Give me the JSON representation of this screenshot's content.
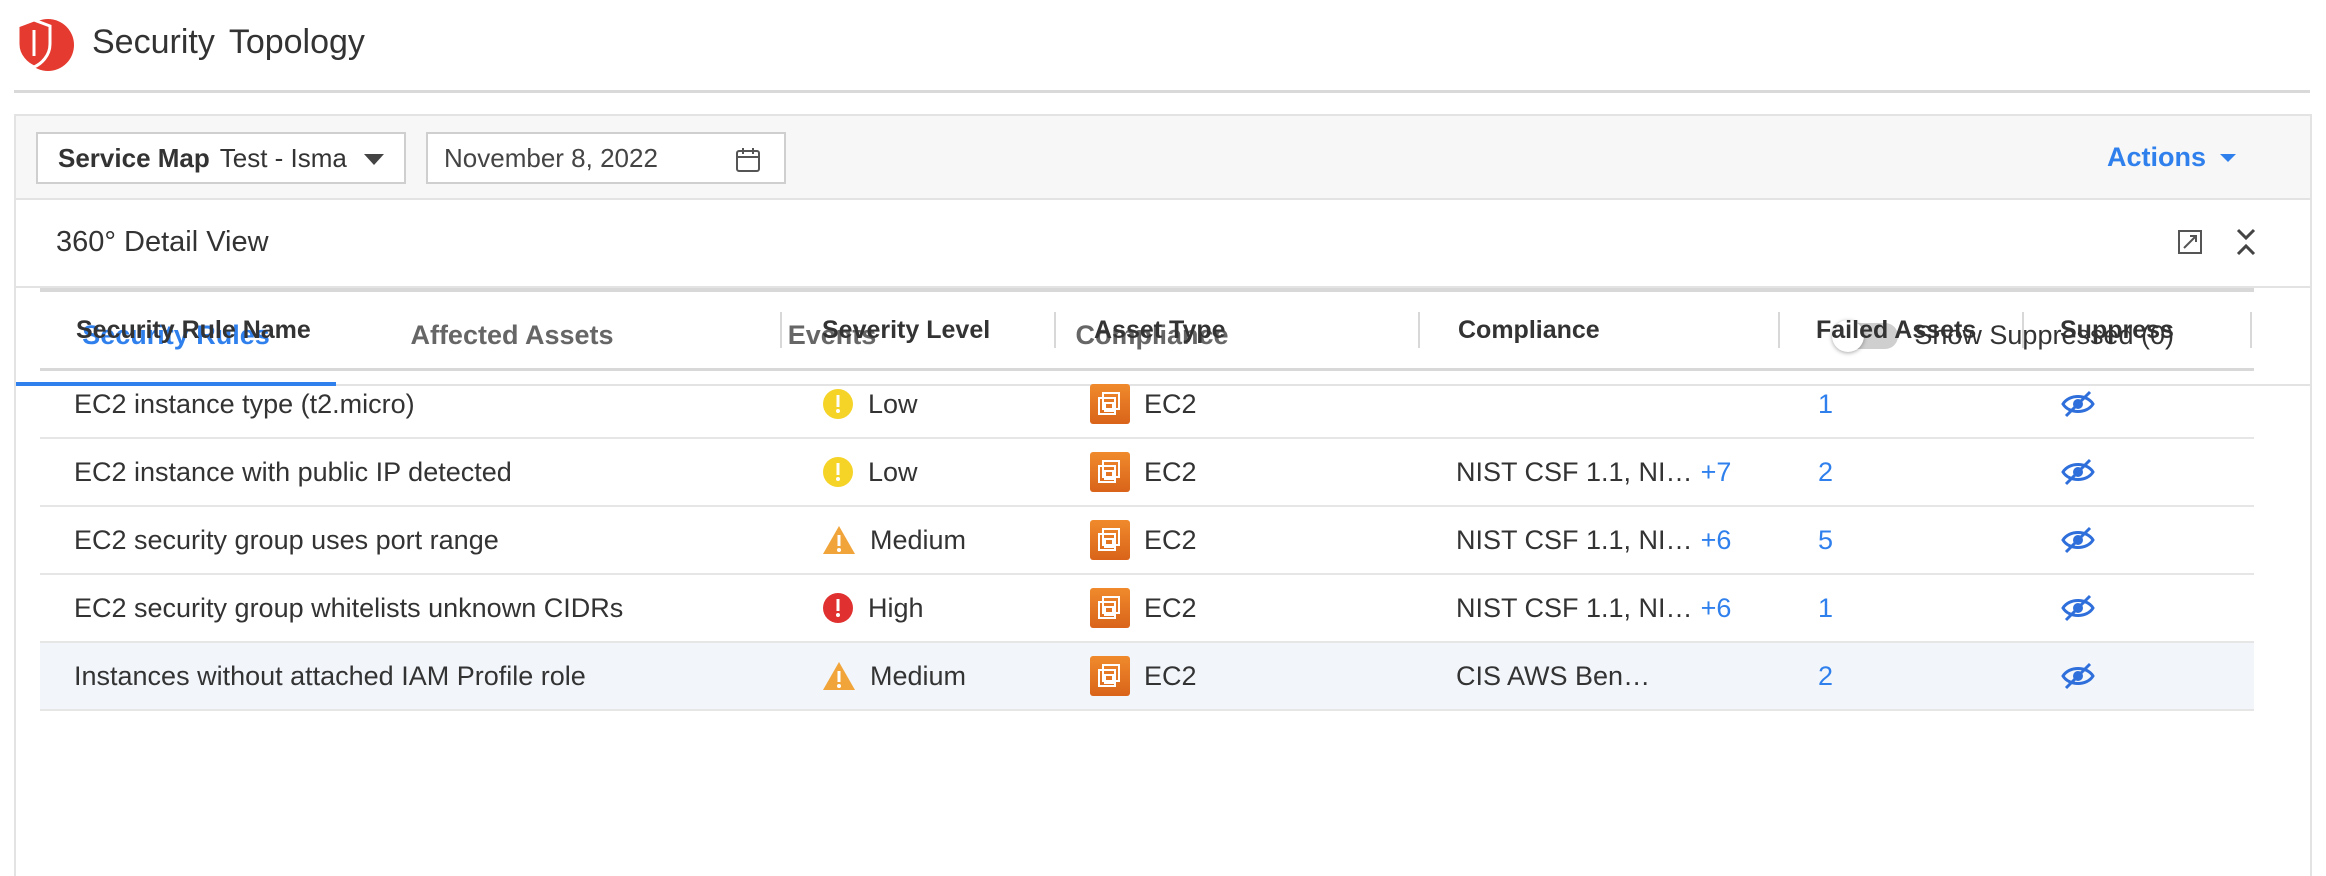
{
  "header": {
    "title": "Security",
    "subtitle": "Topology"
  },
  "toolbar": {
    "service_map_label": "Service Map",
    "service_map_value": "Test - Isma",
    "date_value": "November 8, 2022",
    "actions_label": "Actions"
  },
  "detail": {
    "title": "360° Detail View"
  },
  "tabs": [
    {
      "label": "Security Rules",
      "active": true
    },
    {
      "label": "Affected Assets",
      "active": false
    },
    {
      "label": "Events",
      "active": false
    },
    {
      "label": "Compliance",
      "active": false
    }
  ],
  "suppressed_toggle": {
    "label": "Show Suppressed (0)",
    "on": false
  },
  "table": {
    "columns": [
      "Security Rule Name",
      "Severity Level",
      "Asset Type",
      "Compliance",
      "Failed Assets",
      "Suppress"
    ],
    "rows": [
      {
        "name": "EC2 instance type (t2.micro)",
        "severity": "Low",
        "severity_icon": "info-yellow-icon",
        "asset_type": "EC2",
        "compliance": "",
        "compliance_more": "",
        "failed_assets": "1"
      },
      {
        "name": "EC2 instance with public IP detected",
        "severity": "Low",
        "severity_icon": "info-yellow-icon",
        "asset_type": "EC2",
        "compliance": "NIST CSF 1.1, NI…",
        "compliance_more": "+7",
        "failed_assets": "2"
      },
      {
        "name": "EC2 security group uses port range",
        "severity": "Medium",
        "severity_icon": "warning-triangle-icon",
        "asset_type": "EC2",
        "compliance": "NIST CSF 1.1, NI…",
        "compliance_more": "+6",
        "failed_assets": "5"
      },
      {
        "name": "EC2 security group whitelists unknown CIDRs",
        "severity": "High",
        "severity_icon": "error-red-icon",
        "asset_type": "EC2",
        "compliance": "NIST CSF 1.1, NI…",
        "compliance_more": "+6",
        "failed_assets": "1"
      },
      {
        "name": "Instances without attached IAM Profile role",
        "severity": "Medium",
        "severity_icon": "warning-triangle-icon",
        "asset_type": "EC2",
        "compliance": "CIS AWS Ben…",
        "compliance_more": "",
        "failed_assets": "2"
      }
    ]
  },
  "colors": {
    "accent": "#2f80ed",
    "logo_red": "#e53a2f",
    "low": "#f5d327",
    "medium": "#f0a43a",
    "high": "#e03030",
    "ec2": "#e8792a"
  }
}
